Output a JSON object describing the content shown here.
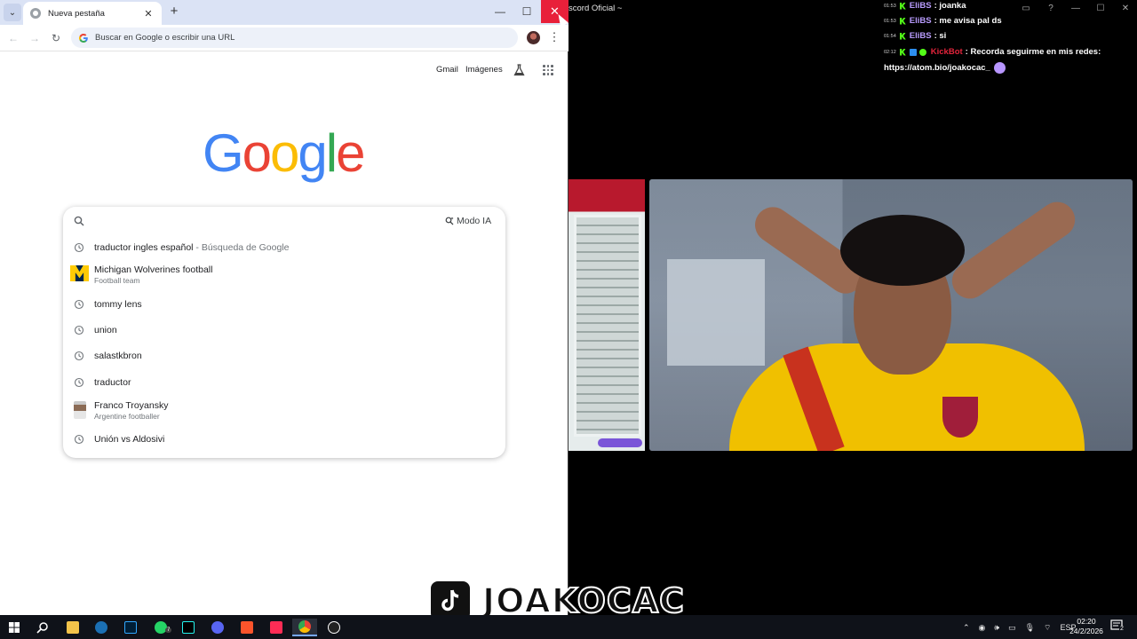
{
  "browser": {
    "tab_title": "Nueva pestaña",
    "omnibox_placeholder": "Buscar en Google o escribir una URL",
    "top_links": {
      "gmail": "Gmail",
      "images": "Imágenes"
    },
    "logo_letters": [
      {
        "ch": "G",
        "color": "#4285F4"
      },
      {
        "ch": "o",
        "color": "#EA4335"
      },
      {
        "ch": "o",
        "color": "#FBBC05"
      },
      {
        "ch": "g",
        "color": "#4285F4"
      },
      {
        "ch": "l",
        "color": "#34A853"
      },
      {
        "ch": "e",
        "color": "#EA4335"
      }
    ],
    "ai_mode_label": "Modo IA",
    "suggestions": [
      {
        "text": "traductor ingles español",
        "sub": " - Búsqueda de Google",
        "icon": "history-icon"
      },
      {
        "text": "Michigan Wolverines football",
        "note": "Football team",
        "icon": "michigan-logo"
      },
      {
        "text": "tommy lens",
        "icon": "history-icon"
      },
      {
        "text": "union",
        "icon": "history-icon"
      },
      {
        "text": "salastkbron",
        "icon": "history-icon"
      },
      {
        "text": "traductor",
        "icon": "history-icon"
      },
      {
        "text": "Franco Troyansky",
        "note": "Argentine footballer",
        "icon": "person-thumbnail"
      },
      {
        "text": "Unión vs Aldosivi",
        "icon": "history-icon"
      }
    ]
  },
  "stream": {
    "window_title": "scord Oficial ~",
    "chat": [
      {
        "time": "01:53",
        "user": "EliBS",
        "user_color": "#b99cff",
        "message": ": joanka"
      },
      {
        "time": "01:53",
        "user": "EliBS",
        "user_color": "#b99cff",
        "message": ": me avisa pal ds"
      },
      {
        "time": "01:54",
        "user": "EliBS",
        "user_color": "#b99cff",
        "message": ": si"
      },
      {
        "time": "02:12",
        "user": "KickBot",
        "user_color": "#e3243b",
        "message": ": Recorda seguirme en mis redes:",
        "continuation": "https://atom.bio/joakocac_"
      }
    ],
    "watermark": "JOAKOCAC"
  },
  "taskbar": {
    "language": "ESP",
    "time": "02:20",
    "date": "24/2/2026",
    "notifications": "2",
    "whatsapp_badge": "7"
  }
}
